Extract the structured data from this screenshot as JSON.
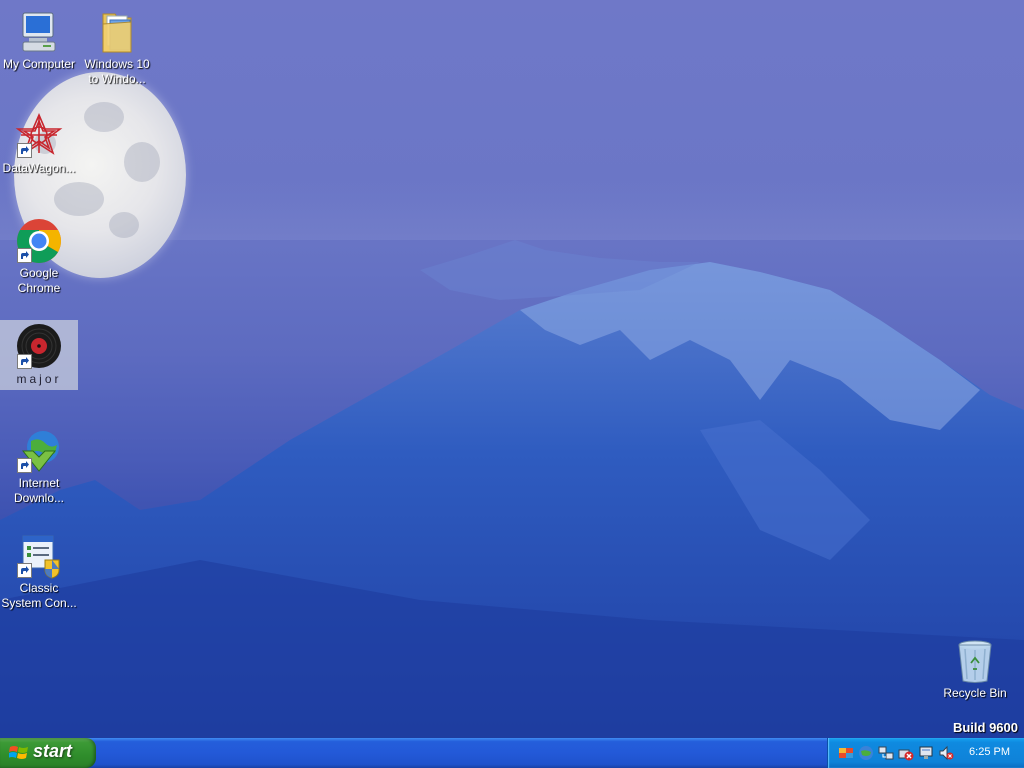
{
  "desktop": {
    "icons": [
      {
        "label": "My Computer",
        "icon": "my-computer-icon"
      },
      {
        "label": "Windows 10\nto Windo...",
        "icon": "folder-icon"
      },
      {
        "label": "DataWagon...",
        "icon": "datawagon-icon"
      },
      {
        "label": "Google\nChrome",
        "icon": "chrome-icon"
      },
      {
        "label": "major",
        "icon": "vinyl-record-icon"
      },
      {
        "label": "Internet\nDownlo...",
        "icon": "internet-download-manager-icon"
      },
      {
        "label": "Classic\nSystem Con...",
        "icon": "control-panel-icon"
      },
      {
        "label": "Recycle Bin",
        "icon": "recycle-bin-icon"
      }
    ],
    "build_text": "Build 9600"
  },
  "taskbar": {
    "start_label": "start",
    "tray_icons": [
      "security-center-icon",
      "network-globe-icon",
      "network-connections-icon",
      "safely-remove-icon",
      "network-disconnected-icon",
      "volume-muted-icon"
    ],
    "clock": "6:25 PM"
  },
  "colors": {
    "taskbar_blue": "#245edb",
    "start_green": "#3c9a36",
    "tray_blue": "#0f8ae0"
  }
}
